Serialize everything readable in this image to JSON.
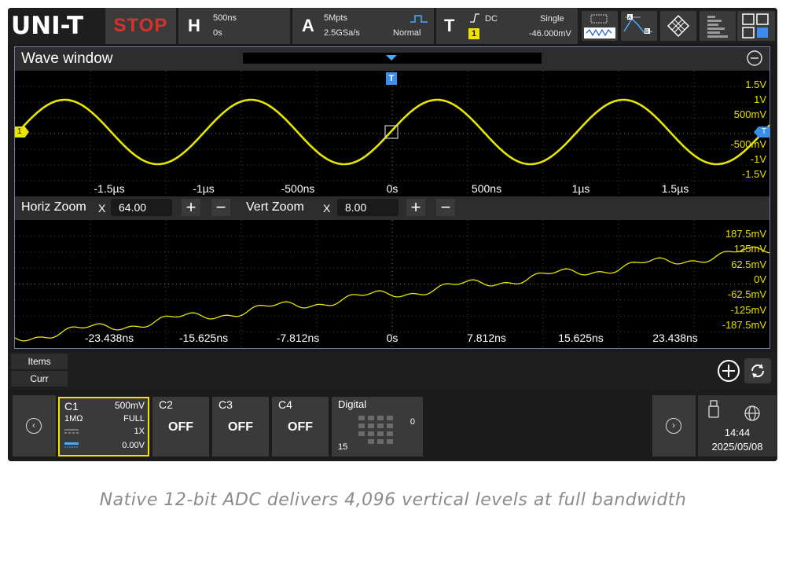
{
  "topbar": {
    "brand": "UNI-T",
    "run_state": "STOP",
    "horizontal": {
      "letter": "H",
      "timebase": "500ns",
      "position": "0s"
    },
    "acquire": {
      "letter": "A",
      "memory": "5Mpts",
      "sample_rate": "2.5GSa/s",
      "mode": "Normal"
    },
    "trigger": {
      "letter": "T",
      "coupling": "DC",
      "source": "1",
      "sweep": "Single",
      "level": "-46.000mV"
    },
    "icons": [
      "measure-icon",
      "cursor-icon",
      "display-icon",
      "utility-icon",
      "menu-icon"
    ]
  },
  "wave_window": {
    "title": "Wave window",
    "main_y_ticks": [
      "1.5V",
      "1V",
      "500mV",
      "",
      "-500mV",
      "-1V",
      "-1.5V"
    ],
    "main_x_ticks": [
      "-1.5µs",
      "-1µs",
      "-500ns",
      "0s",
      "500ns",
      "1µs",
      "1.5µs"
    ],
    "zoom_y_ticks": [
      "187.5mV",
      "125mV",
      "62.5mV",
      "0V",
      "-62.5mV",
      "-125mV",
      "-187.5mV"
    ],
    "zoom_x_ticks": [
      "-23.438ns",
      "-15.625ns",
      "-7.812ns",
      "0s",
      "7.812ns",
      "15.625ns",
      "23.438ns"
    ],
    "trigger_marker": "T",
    "ch1_marker": "1",
    "trigger_level_marker": "T",
    "waveform_color": "#e6e600"
  },
  "zoom_controls": {
    "horiz_label": "Horiz Zoom",
    "horiz_x": "X",
    "horiz_value": "64.00",
    "vert_label": "Vert Zoom",
    "vert_x": "X",
    "vert_value": "8.00",
    "plus": "+",
    "minus": "−"
  },
  "items": {
    "items_label": "Items",
    "curr_label": "Curr"
  },
  "channels": {
    "c1": {
      "name": "C1",
      "scale": "500mV",
      "impedance": "1MΩ",
      "bandwidth": "FULL",
      "probe": "1X",
      "offset": "0.00V"
    },
    "c2": {
      "name": "C2",
      "state": "OFF"
    },
    "c3": {
      "name": "C3",
      "state": "OFF"
    },
    "c4": {
      "name": "C4",
      "state": "OFF"
    },
    "digital": {
      "name": "Digital",
      "low": "15",
      "high": "0"
    }
  },
  "system": {
    "time": "14:44",
    "date": "2025/05/08"
  },
  "caption": "Native 12-bit ADC delivers 4,096 vertical levels at full bandwidth"
}
